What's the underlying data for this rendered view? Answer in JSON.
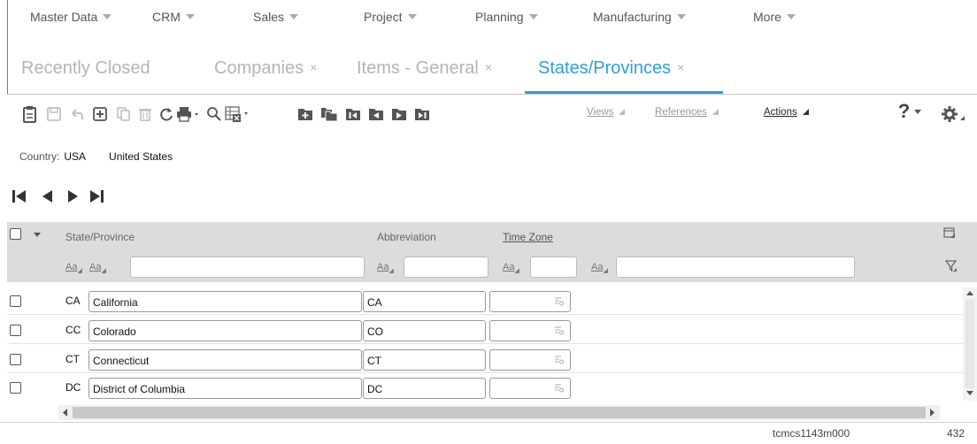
{
  "menu": [
    {
      "label": "Master Data"
    },
    {
      "label": "CRM"
    },
    {
      "label": "Sales"
    },
    {
      "label": "Project"
    },
    {
      "label": "Planning"
    },
    {
      "label": "Manufacturing"
    },
    {
      "label": "More"
    }
  ],
  "tabs": [
    {
      "label": "Recently Closed"
    },
    {
      "label": "Companies"
    },
    {
      "label": "Items - General"
    },
    {
      "label": "States/Provinces"
    }
  ],
  "tab_close": "×",
  "toolbar": {
    "views": "Views",
    "references": "References",
    "actions": "Actions",
    "help": "?"
  },
  "country": {
    "label": "Country:",
    "code": "USA",
    "name": "United States"
  },
  "grid": {
    "columns": {
      "state": "State/Province",
      "abbreviation": "Abbreviation",
      "timezone": "Time Zone"
    },
    "filter_glyph": "Aa",
    "rows": [
      {
        "code": "CA",
        "name": "California",
        "abbr": "CA"
      },
      {
        "code": "CC",
        "name": "Colorado",
        "abbr": "CO"
      },
      {
        "code": "CT",
        "name": "Connecticut",
        "abbr": "CT"
      },
      {
        "code": "DC",
        "name": "District of Columbia",
        "abbr": "DC"
      }
    ]
  },
  "status": {
    "session": "tcmcs1143m000",
    "count": "432"
  },
  "colors": {
    "accent": "#2e9fd9",
    "header_bg": "#dcdcdc",
    "muted_text": "#b4b4b4"
  }
}
